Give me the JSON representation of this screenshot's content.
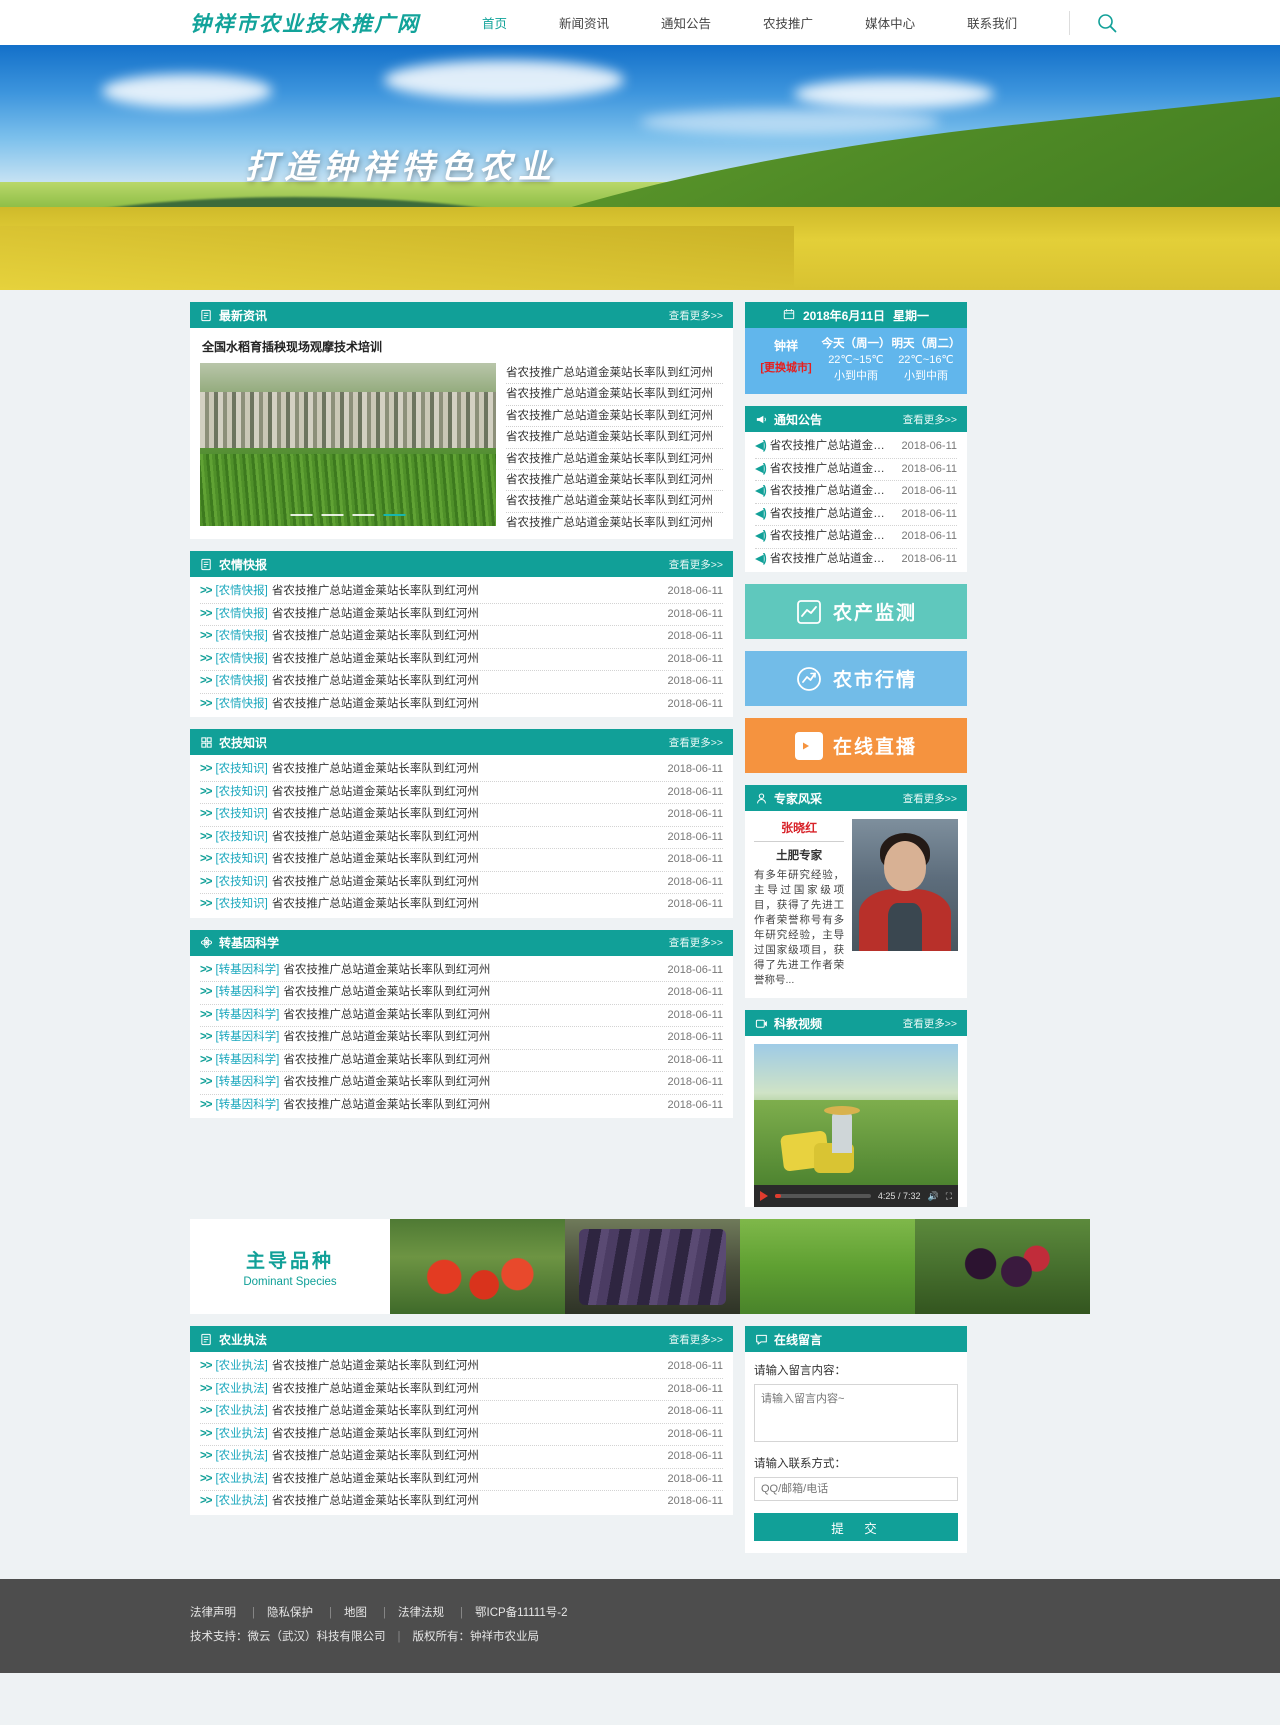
{
  "site": {
    "logo": "钟祥市农业技术推广网",
    "hero_title": "打造钟祥特色农业"
  },
  "nav": {
    "items": [
      {
        "label": "首页",
        "active": true
      },
      {
        "label": "新闻资讯",
        "active": false
      },
      {
        "label": "通知公告",
        "active": false
      },
      {
        "label": "农技推广",
        "active": false
      },
      {
        "label": "媒体中心",
        "active": false
      },
      {
        "label": "联系我们",
        "active": false
      }
    ],
    "search_icon": "search-icon"
  },
  "common": {
    "more": "查看更多>>",
    "arrow": ">>",
    "date": "2018-06-11",
    "item_title": "省农技推广总站道金莱站长率队到红河州"
  },
  "latest_news": {
    "title": "最新资讯",
    "icon": "document-icon",
    "more": "查看更多>>",
    "feature_title": "全国水稻育插秧现场观摩技术培训",
    "image_alt": "水稻育插秧现场观摩培训现场",
    "slide_count": 4,
    "active_slide": 4,
    "items": [
      "省农技推广总站道金莱站长率队到红河州",
      "省农技推广总站道金莱站长率队到红河州",
      "省农技推广总站道金莱站长率队到红河州",
      "省农技推广总站道金莱站长率队到红河州",
      "省农技推广总站道金莱站长率队到红河州",
      "省农技推广总站道金莱站长率队到红河州",
      "省农技推广总站道金莱站长率队到红河州",
      "省农技推广总站道金莱站长率队到红河州"
    ]
  },
  "farm_report": {
    "title": "农情快报",
    "icon": "document-icon",
    "more": "查看更多>>",
    "category": "[农情快报]",
    "rows": [
      {
        "title": "省农技推广总站道金莱站长率队到红河州",
        "date": "2018-06-11"
      },
      {
        "title": "省农技推广总站道金莱站长率队到红河州",
        "date": "2018-06-11"
      },
      {
        "title": "省农技推广总站道金莱站长率队到红河州",
        "date": "2018-06-11"
      },
      {
        "title": "省农技推广总站道金莱站长率队到红河州",
        "date": "2018-06-11"
      },
      {
        "title": "省农技推广总站道金莱站长率队到红河州",
        "date": "2018-06-11"
      },
      {
        "title": "省农技推广总站道金莱站长率队到红河州",
        "date": "2018-06-11"
      }
    ]
  },
  "farm_tech": {
    "title": "农技知识",
    "icon": "grid-icon",
    "more": "查看更多>>",
    "category": "[农技知识]",
    "rows": [
      {
        "title": "省农技推广总站道金莱站长率队到红河州",
        "date": "2018-06-11"
      },
      {
        "title": "省农技推广总站道金莱站长率队到红河州",
        "date": "2018-06-11"
      },
      {
        "title": "省农技推广总站道金莱站长率队到红河州",
        "date": "2018-06-11"
      },
      {
        "title": "省农技推广总站道金莱站长率队到红河州",
        "date": "2018-06-11"
      },
      {
        "title": "省农技推广总站道金莱站长率队到红河州",
        "date": "2018-06-11"
      },
      {
        "title": "省农技推广总站道金莱站长率队到红河州",
        "date": "2018-06-11"
      },
      {
        "title": "省农技推广总站道金莱站长率队到红河州",
        "date": "2018-06-11"
      }
    ]
  },
  "gmo_science": {
    "title": "转基因科学",
    "icon": "atom-icon",
    "more": "查看更多>>",
    "category": "[转基因科学]",
    "rows": [
      {
        "title": "省农技推广总站道金莱站长率队到红河州",
        "date": "2018-06-11"
      },
      {
        "title": "省农技推广总站道金莱站长率队到红河州",
        "date": "2018-06-11"
      },
      {
        "title": "省农技推广总站道金莱站长率队到红河州",
        "date": "2018-06-11"
      },
      {
        "title": "省农技推广总站道金莱站长率队到红河州",
        "date": "2018-06-11"
      },
      {
        "title": "省农技推广总站道金莱站长率队到红河州",
        "date": "2018-06-11"
      },
      {
        "title": "省农技推广总站道金莱站长率队到红河州",
        "date": "2018-06-11"
      },
      {
        "title": "省农技推广总站道金莱站长率队到红河州",
        "date": "2018-06-11"
      }
    ]
  },
  "law_enforcement": {
    "title": "农业执法",
    "icon": "document-icon",
    "more": "查看更多>>",
    "category": "[农业执法]",
    "rows": [
      {
        "title": "省农技推广总站道金莱站长率队到红河州",
        "date": "2018-06-11"
      },
      {
        "title": "省农技推广总站道金莱站长率队到红河州",
        "date": "2018-06-11"
      },
      {
        "title": "省农技推广总站道金莱站长率队到红河州",
        "date": "2018-06-11"
      },
      {
        "title": "省农技推广总站道金莱站长率队到红河州",
        "date": "2018-06-11"
      },
      {
        "title": "省农技推广总站道金莱站长率队到红河州",
        "date": "2018-06-11"
      },
      {
        "title": "省农技推广总站道金莱站长率队到红河州",
        "date": "2018-06-11"
      },
      {
        "title": "省农技推广总站道金莱站长率队到红河州",
        "date": "2018-06-11"
      }
    ]
  },
  "weather": {
    "icon": "calendar-icon",
    "date": "2018年6月11日",
    "weekday": "星期一",
    "city": "钟祥",
    "change_city": "[更换城市]",
    "today": {
      "label": "今天（周一）",
      "temp": "22℃~15℃",
      "cond": "小到中雨"
    },
    "tomorrow": {
      "label": "明天（周二）",
      "temp": "22℃~16℃",
      "cond": "小到中雨"
    }
  },
  "notices": {
    "title": "通知公告",
    "icon": "megaphone-icon",
    "more": "查看更多>>",
    "rows": [
      {
        "title": "省农技推广总站道金荣站长",
        "date": "2018-06-11"
      },
      {
        "title": "省农技推广总站道金荣站长",
        "date": "2018-06-11"
      },
      {
        "title": "省农技推广总站道金荣站长",
        "date": "2018-06-11"
      },
      {
        "title": "省农技推广总站道金荣站长",
        "date": "2018-06-11"
      },
      {
        "title": "省农技推广总站道金荣站长",
        "date": "2018-06-11"
      },
      {
        "title": "省农技推广总站道金荣站长",
        "date": "2018-06-11"
      }
    ]
  },
  "quick_buttons": [
    {
      "label": "农产监测",
      "icon": "chart-icon",
      "color": "#5fc8bd"
    },
    {
      "label": "农市行情",
      "icon": "trend-icon",
      "color": "#72bce8"
    },
    {
      "label": "在线直播",
      "icon": "video-icon",
      "color": "#f5933f"
    }
  ],
  "expert": {
    "title": "专家风采",
    "icon": "person-icon",
    "more": "查看更多>>",
    "name": "张晓红",
    "role": "土肥专家",
    "bio": "有多年研究经验，主导过国家级项目，获得了先进工作者荣誉称号有多年研究经验，主导过国家级项目，获得了先进工作者荣誉称号...",
    "photo_alt": "张晓红专家照片"
  },
  "edu_video": {
    "title": "科教视频",
    "icon": "video-icon",
    "more": "查看更多>>",
    "time": "4:25 / 7:32",
    "poster_alt": "农民田间收获作业视频"
  },
  "species": {
    "title_cn": "主导品种",
    "title_en": "Dominant Species",
    "items": [
      {
        "name": "番茄",
        "alt": "成熟番茄"
      },
      {
        "name": "茄子",
        "alt": "紫色茄子"
      },
      {
        "name": "青菜",
        "alt": "绿叶青菜"
      },
      {
        "name": "桑葚",
        "alt": "桑葚果实"
      }
    ]
  },
  "message_form": {
    "title": "在线留言",
    "icon": "message-icon",
    "content_label": "请输入留言内容：",
    "content_placeholder": "请输入留言内容~",
    "contact_label": "请输入联系方式：",
    "contact_placeholder": "QQ/邮箱/电话",
    "submit_label": "提　交"
  },
  "footer": {
    "links": [
      "法律声明",
      "隐私保护",
      "地图",
      "法律法规"
    ],
    "icp": "鄂ICP备11111号-2",
    "support": "技术支持：微云（武汉）科技有限公司",
    "copyright": "版权所有：钟祥市农业局",
    "separator": "|"
  },
  "theme": {
    "primary": "#11a098",
    "blue": "#61b6ec",
    "orange": "#f5933f",
    "red": "#d8232a",
    "link": "#1aa7bd"
  }
}
